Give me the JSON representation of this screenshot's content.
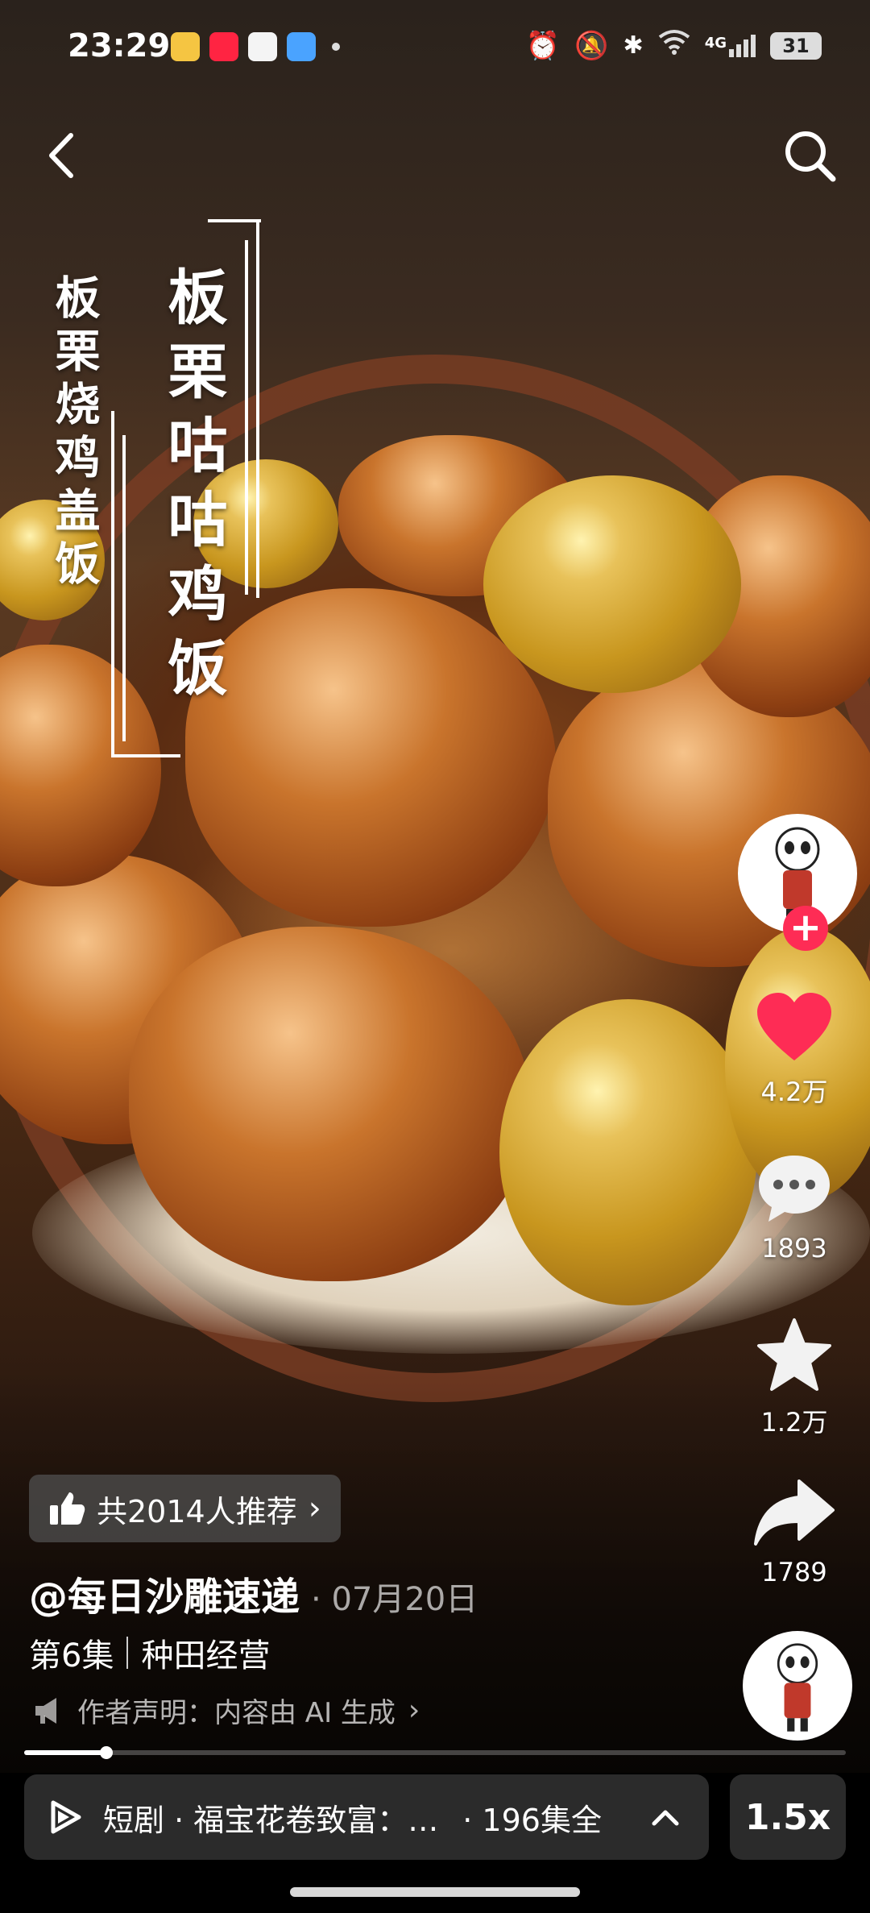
{
  "status_bar": {
    "time": "23:29",
    "network": "4G",
    "battery": "31"
  },
  "nav": {
    "back_icon": "chevron-left-icon",
    "search_icon": "search-icon"
  },
  "overlay": {
    "main_title": "板栗咕咕鸡饭",
    "sub_title": "板栗烧鸡盖饭"
  },
  "rail": {
    "likes": "4.2万",
    "comments": "1893",
    "favorites": "1.2万",
    "shares": "1789"
  },
  "info": {
    "recommend_text": "共2014人推荐",
    "author": "@每日沙雕速递",
    "date": "· 07月20日",
    "episode": "第6集",
    "category": "种田经营",
    "ai_declaration": "作者声明：内容由 AI 生成",
    "progress": 0.1
  },
  "series": {
    "label": "短剧 · 福宝花卷致富：…",
    "count": "· 196集全",
    "speed": "1.5x"
  },
  "colors": {
    "like": "#fe2c55",
    "panel": "#2b2b2b"
  }
}
